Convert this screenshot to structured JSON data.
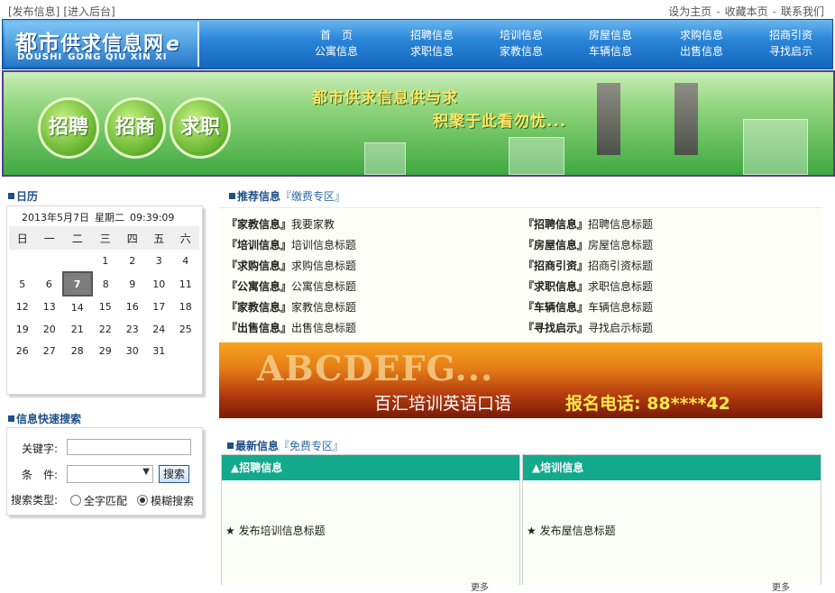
{
  "topbar": {
    "left_links": [
      "[发布信息]",
      "[进入后台]"
    ],
    "right_links": [
      "设为主页",
      "收藏本页",
      "联系我们"
    ],
    "separator": "-"
  },
  "logo": {
    "cn_main": "都市",
    "cn_rest": "供求信息网",
    "cn_e": "e",
    "en": [
      "DOUSHI",
      "GONG QIU XIN XI"
    ]
  },
  "nav": {
    "columns": [
      [
        "首　页",
        "公寓信息"
      ],
      [
        "招聘信息",
        "求职信息"
      ],
      [
        "培训信息",
        "家教信息"
      ],
      [
        "房屋信息",
        "车辆信息"
      ],
      [
        "求购信息",
        "出售信息"
      ],
      [
        "招商引资",
        "寻找启示"
      ]
    ]
  },
  "banner": {
    "bubbles": [
      "招聘",
      "招商",
      "求职"
    ],
    "slogan1": "都市供求信息供与求",
    "slogan2": "积聚于此看勿忧..."
  },
  "calendar": {
    "title": "日历",
    "date": "2013年5月7日",
    "weekday": "星期二",
    "time": "09:39:09",
    "weekdays": [
      "日",
      "一",
      "二",
      "三",
      "四",
      "五",
      "六"
    ],
    "weeks": [
      [
        "",
        "",
        "",
        "1",
        "2",
        "3",
        "4"
      ],
      [
        "5",
        "6",
        "7",
        "8",
        "9",
        "10",
        "11"
      ],
      [
        "12",
        "13",
        "14",
        "15",
        "16",
        "17",
        "18"
      ],
      [
        "19",
        "20",
        "21",
        "22",
        "23",
        "24",
        "25"
      ],
      [
        "26",
        "27",
        "28",
        "29",
        "30",
        "31",
        ""
      ]
    ],
    "today": "7"
  },
  "search": {
    "title": "信息快速搜索",
    "keyword_label": "关键字:",
    "keyword_value": "",
    "condition_label": "条　件:",
    "condition_value": "",
    "button": "搜索",
    "type_label": "搜索类型:",
    "options": [
      "全字匹配",
      "模糊搜索"
    ],
    "selected_option": "模糊搜索"
  },
  "recommended": {
    "title": "推荐信息",
    "zone": "『缴费专区』",
    "left": [
      {
        "cat": "『家教信息』",
        "text": "我要家教"
      },
      {
        "cat": "『培训信息』",
        "text": "培训信息标题"
      },
      {
        "cat": "『求购信息』",
        "text": "求购信息标题"
      },
      {
        "cat": "『公寓信息』",
        "text": "公寓信息标题"
      },
      {
        "cat": "『家教信息』",
        "text": "家教信息标题"
      },
      {
        "cat": "『出售信息』",
        "text": "出售信息标题"
      }
    ],
    "right": [
      {
        "cat": "『招聘信息』",
        "text": "招聘信息标题"
      },
      {
        "cat": "『房屋信息』",
        "text": "房屋信息标题"
      },
      {
        "cat": "『招商引资』",
        "text": "招商引资标题"
      },
      {
        "cat": "『求职信息』",
        "text": "求职信息标题"
      },
      {
        "cat": "『车辆信息』",
        "text": "车辆信息标题"
      },
      {
        "cat": "『寻找启示』",
        "text": "寻找启示标题"
      }
    ]
  },
  "ad": {
    "big": "ABCDEFG...",
    "sub": "百汇培训英语口语",
    "tel": "报名电话: 88****42"
  },
  "latest": {
    "title": "最新信息",
    "zone": "『免费专区』",
    "panels": [
      {
        "header": "▲招聘信息",
        "item": "★ 发布培训信息标题",
        "more": "更多"
      },
      {
        "header": "▲培训信息",
        "item": "★ 发布屋信息标题",
        "more": "更多"
      }
    ]
  }
}
